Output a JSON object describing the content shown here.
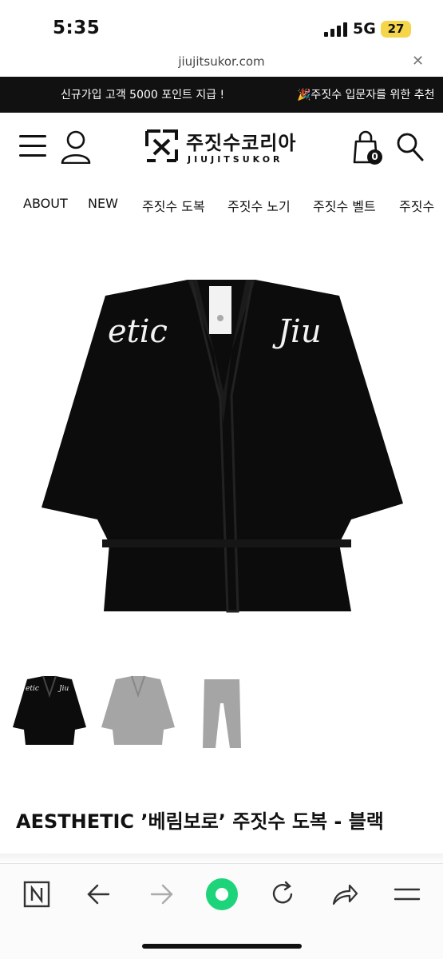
{
  "status": {
    "time": "5:35",
    "network": "5G",
    "battery": "27"
  },
  "browser": {
    "url": "jiujitsukor.com"
  },
  "promo": {
    "items": [
      "신규가입 고객 5000 포인트 지급 !",
      "🎉주짓수 입문자를 위한 추천"
    ]
  },
  "header": {
    "logo_korean": "주짓수코리아",
    "logo_english": "JIUJITSUKOR",
    "cart_count": "0"
  },
  "nav": {
    "items": [
      "ABOUT",
      "NEW",
      "주짓수 도복",
      "주짓수 노기",
      "주짓수 벨트",
      "주짓수"
    ]
  },
  "product": {
    "title": "AESTHETIC ’베림보로’ 주짓수 도복 - 블랙",
    "print_left": "etic",
    "print_right": "Jiu",
    "thumbnails": [
      "black-gi-jacket",
      "grey-gi-jacket",
      "grey-gi-pants"
    ]
  },
  "toolbar": {
    "items": [
      "naver-icon",
      "back-icon",
      "forward-icon",
      "home-icon",
      "refresh-icon",
      "share-icon",
      "menu-icon"
    ]
  },
  "colors": {
    "accent_green": "#1ed47a",
    "promo_bg": "#111111",
    "battery": "#f5d64a"
  }
}
